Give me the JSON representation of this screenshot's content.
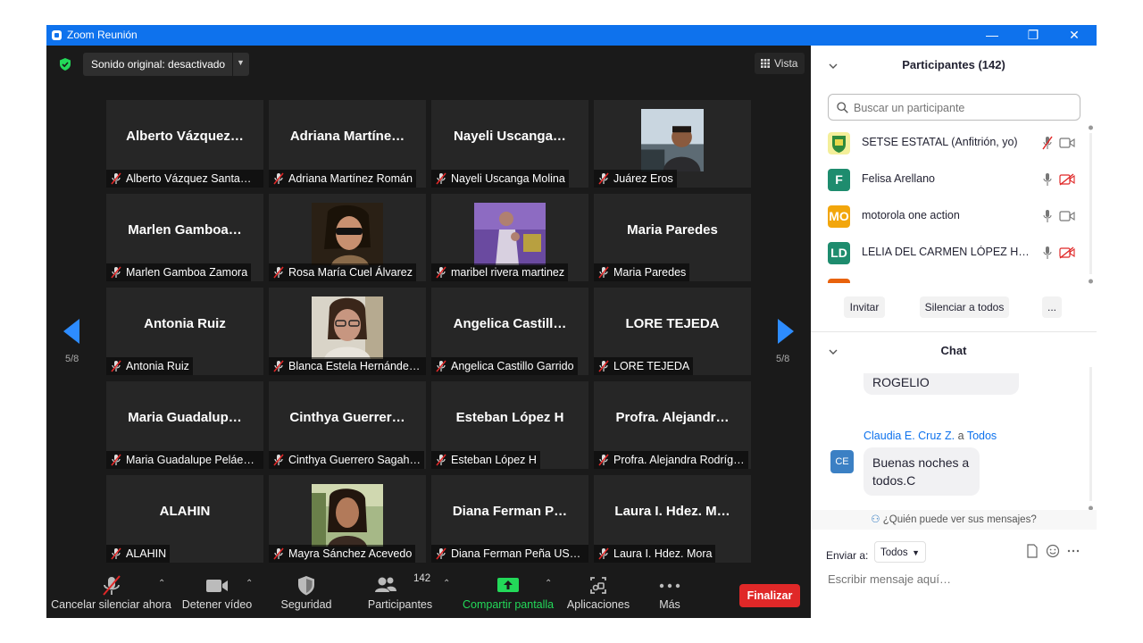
{
  "window": {
    "title": "Zoom Reunión",
    "minimize": "—",
    "restore": "❐",
    "close": "✕"
  },
  "meeting": {
    "audio_dropdown": "Sonido original: desactivado",
    "view_label": "Vista",
    "page_left": "5/8",
    "page_right": "5/8",
    "tiles": [
      {
        "big": "Alberto  Vázquez…",
        "name": "Alberto Vázquez Santam…",
        "photo": null
      },
      {
        "big": "Adriana  Martíne…",
        "name": "Adriana Martínez Román",
        "photo": null
      },
      {
        "big": "Nayeli  Uscanga…",
        "name": "Nayeli Uscanga Molina",
        "photo": null
      },
      {
        "big": "",
        "name": "Juárez Eros",
        "photo": "eros"
      },
      {
        "big": "Marlen  Gamboa…",
        "name": "Marlen Gamboa Zamora",
        "photo": null
      },
      {
        "big": "",
        "name": "Rosa María Cuel Álvarez",
        "photo": "rosa"
      },
      {
        "big": "",
        "name": "maribel rivera martinez",
        "photo": "maribel"
      },
      {
        "big": "Maria Paredes",
        "name": "Maria Paredes",
        "photo": null
      },
      {
        "big": "Antonia Ruiz",
        "name": "Antonia Ruiz",
        "photo": null
      },
      {
        "big": "",
        "name": "Blanca Estela Hernández…",
        "photo": "blanca"
      },
      {
        "big": "Angelica  Castill…",
        "name": "Angelica Castillo Garrido",
        "photo": null
      },
      {
        "big": "LORE TEJEDA",
        "name": "LORE TEJEDA",
        "photo": null
      },
      {
        "big": "Maria  Guadalup…",
        "name": "Maria Guadalupe Peláez…",
        "photo": null
      },
      {
        "big": "Cinthya  Guerrer…",
        "name": "Cinthya Guerrero Sagah…",
        "photo": null
      },
      {
        "big": "Esteban López H",
        "name": "Esteban López H",
        "photo": null
      },
      {
        "big": "Profra.  Alejandr…",
        "name": "Profra. Alejandra Rodríg…",
        "photo": null
      },
      {
        "big": "ALAHIN",
        "name": "ALAHIN",
        "photo": null
      },
      {
        "big": "",
        "name": "Mayra Sánchez Acevedo",
        "photo": "mayra"
      },
      {
        "big": "Diana Ferman P…",
        "name": "Diana Ferman Peña USA…",
        "photo": null
      },
      {
        "big": "Laura I. Hdez. M…",
        "name": "Laura I. Hdez. Mora",
        "photo": null
      }
    ]
  },
  "toolbar": {
    "unmute": "Cancelar silenciar ahora",
    "stop_video": "Detener vídeo",
    "security": "Seguridad",
    "participants": "Participantes",
    "participants_count": "142",
    "share": "Compartir pantalla",
    "apps": "Aplicaciones",
    "more": "Más",
    "end": "Finalizar"
  },
  "participants_panel": {
    "title": "Participantes (142)",
    "search_placeholder": "Buscar un participante",
    "list": [
      {
        "initials": "",
        "name": "SETSE ESTATAL (Anfitrión, yo)",
        "color": "#e8d84a"
      },
      {
        "initials": "F",
        "name": "Felisa Arellano",
        "color": "#1e8c6e"
      },
      {
        "initials": "MO",
        "name": "motorola one action",
        "color": "#f2a60c"
      },
      {
        "initials": "LD",
        "name": "LELIA DEL CARMEN LÓPEZ HUE…",
        "color": "#1e8c6e"
      }
    ],
    "invite": "Invitar",
    "mute_all": "Silenciar a todos",
    "more": "..."
  },
  "chat": {
    "title": "Chat",
    "prev_message": "ROGELIO",
    "sender": "Claudia E. Cruz Z.",
    "to_prefix": "a",
    "to": "Todos",
    "avatar_initials": "CE",
    "message": "Buenas noches a todos.C",
    "who_can_see": "¿Quién puede ver sus mensajes?",
    "send_to_label": "Enviar a:",
    "send_to_value": "Todos",
    "input_placeholder": "Escribir mensaje aquí…"
  }
}
